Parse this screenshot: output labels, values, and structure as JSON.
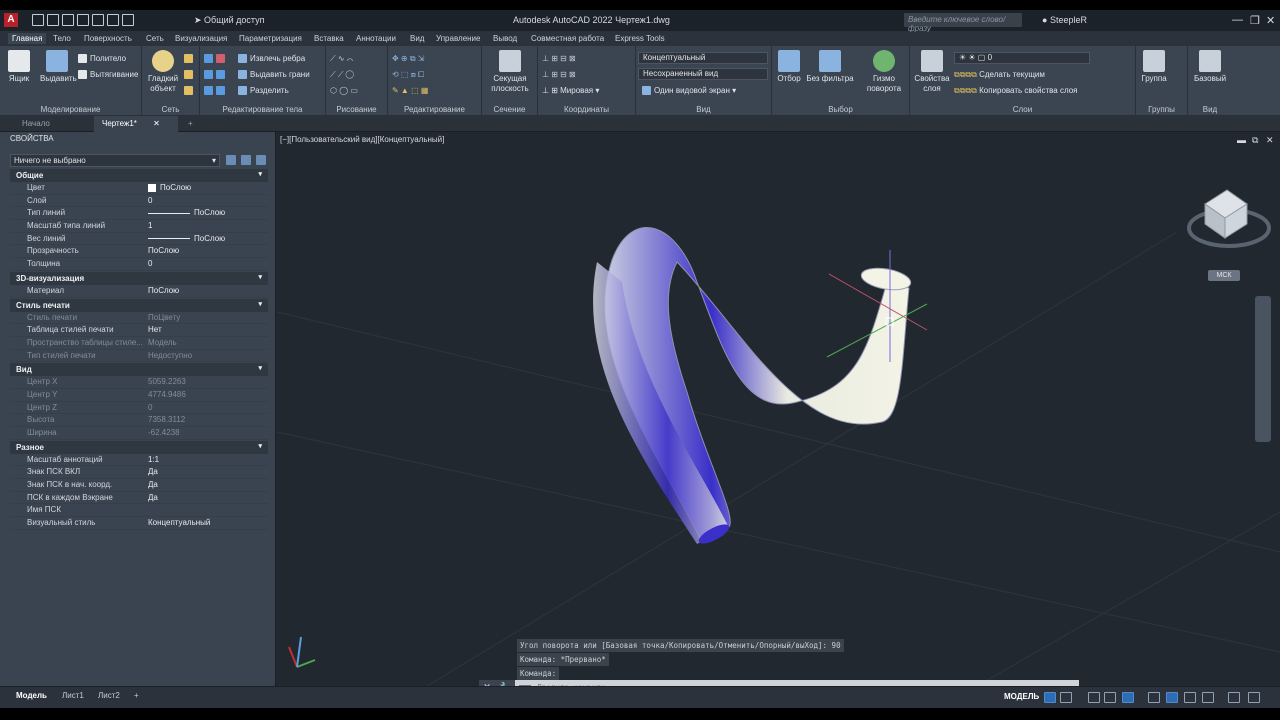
{
  "app": {
    "title": "Autodesk AutoCAD 2022   Чертеж1.dwg",
    "share_label": "Общий доступ",
    "search_placeholder": "Введите ключевое слово/фразу",
    "user": "SteepleR"
  },
  "ribbon_tabs": [
    "Главная",
    "Тело",
    "Поверхность",
    "Сеть",
    "Визуализация",
    "Параметризация",
    "Вставка",
    "Аннотации",
    "Вид",
    "Управление",
    "Вывод",
    "Совместная работа",
    "Express Tools"
  ],
  "ribbon": {
    "modeling": {
      "label": "Моделирование",
      "box": "Ящик",
      "extrude": "Выдавить",
      "polysolid": "Политело",
      "presspull": "Вытягивание"
    },
    "mesh": {
      "label": "Сеть",
      "smooth": "Гладкий объект"
    },
    "solid_edit": {
      "label": "Редактирование тела",
      "extract_edges": "Извлечь ребра",
      "extrude_faces": "Выдавить грани",
      "separate": "Разделить"
    },
    "draw": {
      "label": "Рисование"
    },
    "modify": {
      "label": "Редактирование"
    },
    "section": {
      "label": "Сечение",
      "plane": "Секущая плоскость"
    },
    "coords": {
      "label": "Координаты",
      "ucs": "Мировая"
    },
    "view": {
      "label": "Вид",
      "visual_style": "Концептуальный",
      "saved_view": "Несохраненный вид",
      "viewport": "Один видовой экран"
    },
    "selection": {
      "label": "Выбор",
      "culling": "Отбор",
      "no_filter": "Без фильтра",
      "gizmo": "Гизмо поворота"
    },
    "layers": {
      "label": "Слои",
      "props": "Свойства слоя",
      "current_layer": "0",
      "make_current": "Сделать текущим",
      "match_layer": "Копировать свойства слоя"
    },
    "groups": {
      "label": "Группы",
      "group": "Группа"
    },
    "view2": {
      "label": "Вид",
      "base": "Базовый"
    }
  },
  "doc_tabs": {
    "start": "Начало",
    "drawing": "Чертеж1*"
  },
  "palette": {
    "title": "СВОЙСТВА",
    "selection": "Ничего не выбрано",
    "sections": [
      {
        "name": "Общие",
        "rows": [
          {
            "k": "Цвет",
            "v": "ПоСлою",
            "swatch": true
          },
          {
            "k": "Слой",
            "v": "0"
          },
          {
            "k": "Тип линий",
            "v": "ПоСлою",
            "line": true
          },
          {
            "k": "Масштаб типа линий",
            "v": "1"
          },
          {
            "k": "Вес линий",
            "v": "ПоСлою",
            "line": true
          },
          {
            "k": "Прозрачность",
            "v": "ПоСлою"
          },
          {
            "k": "Толщина",
            "v": "0"
          }
        ]
      },
      {
        "name": "3D-визуализация",
        "rows": [
          {
            "k": "Материал",
            "v": "ПоСлою"
          }
        ]
      },
      {
        "name": "Стиль печати",
        "rows": [
          {
            "k": "Стиль печати",
            "v": "ПоЦвету",
            "dis": true
          },
          {
            "k": "Таблица стилей печати",
            "v": "Нет"
          },
          {
            "k": "Пространство таблицы стиле...",
            "v": "Модель",
            "dis": true
          },
          {
            "k": "Тип стилей печати",
            "v": "Недоступно",
            "dis": true
          }
        ]
      },
      {
        "name": "Вид",
        "rows": [
          {
            "k": "Центр X",
            "v": "5059.2263",
            "dis": true
          },
          {
            "k": "Центр Y",
            "v": "4774.9486",
            "dis": true
          },
          {
            "k": "Центр Z",
            "v": "0",
            "dis": true
          },
          {
            "k": "Высота",
            "v": "7358.3112",
            "dis": true
          },
          {
            "k": "Ширина",
            "v": "-62.4238",
            "dis": true
          }
        ]
      },
      {
        "name": "Разное",
        "rows": [
          {
            "k": "Масштаб аннотаций",
            "v": "1:1"
          },
          {
            "k": "Знак ПСК ВКЛ",
            "v": "Да"
          },
          {
            "k": "Знак ПСК в нач. коорд.",
            "v": "Да"
          },
          {
            "k": "ПСК в каждом Вэкране",
            "v": "Да"
          },
          {
            "k": "Имя ПСК",
            "v": ""
          },
          {
            "k": "Визуальный стиль",
            "v": "Концептуальный"
          }
        ]
      }
    ]
  },
  "viewport": {
    "label": "[−][Пользовательский вид][Концептуальный]",
    "wcs": "МСК"
  },
  "command": {
    "history": [
      "Угол поворота или [Базовая точка/Копировать/Отменить/Опорный/выХод]: 90",
      "Команда: *Прервано*",
      "Команда:"
    ],
    "placeholder": "Введите команду"
  },
  "status": {
    "layouts": [
      "Модель",
      "Лист1",
      "Лист2"
    ],
    "mode": "МОДЕЛЬ"
  },
  "colors": {
    "accent": "#2f6db3",
    "tube_shade": "#3a2fc8",
    "tube_light": "#eef0dc"
  }
}
